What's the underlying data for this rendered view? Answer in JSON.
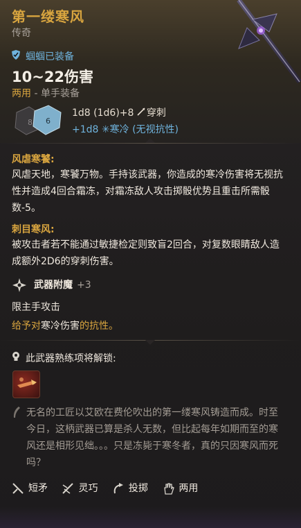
{
  "item": {
    "name": "第一缕寒风",
    "rarity": "传奇",
    "equipped": "蝈蝈已装备",
    "damage": "10~22伤害",
    "hand_type": "两用",
    "hand_sub": " - 单手装备",
    "damage_line1": "1d8 (1d6)+8",
    "damage_type1": "穿刺",
    "damage_line2": "+1d8",
    "damage_type2": "寒冷 (无视抗性)",
    "dice_numbers": [
      "8",
      "6"
    ]
  },
  "passives": [
    {
      "title": "风虐寒饕:",
      "text": "风虐天地，寒饕万物。手持该武器，你造成的寒冷伤害将无视抗性并造成4回合霜冻，对霜冻敌人攻击掷骰优势且重击所需骰数-5。"
    },
    {
      "title": "刺目寒风:",
      "text": "被攻击者若不能通过敏捷检定则致盲2回合，对复数眼睛敌人造成额外2D6的穿刺伤害。"
    }
  ],
  "enchant": {
    "label": "武器附魔",
    "value": "+3",
    "offhand": "限主手攻击",
    "resist_prefix": "给予对",
    "resist_type": "寒冷伤害",
    "resist_suffix": "的抗性。"
  },
  "unlock": {
    "label": "此武器熟练项将解锁:"
  },
  "lore": "无名的工匠以艾欧在费伦吹出的第一缕寒风铸造而成。时至今日，这柄武器已算是杀人无数，但比起每年如期而至的寒风还是相形见绌。。。只是冻毙于寒冬者，真的只因寒风而死吗？",
  "properties": [
    {
      "label": "短矛",
      "icon": "spear-icon"
    },
    {
      "label": "灵巧",
      "icon": "finesse-icon"
    },
    {
      "label": "投掷",
      "icon": "thrown-icon"
    },
    {
      "label": "两用",
      "icon": "versatile-hand-icon"
    }
  ],
  "colors": {
    "gold": "#d9a53f",
    "blue": "#6fb3dd",
    "text": "#efe8de",
    "muted": "#a8a19a"
  }
}
